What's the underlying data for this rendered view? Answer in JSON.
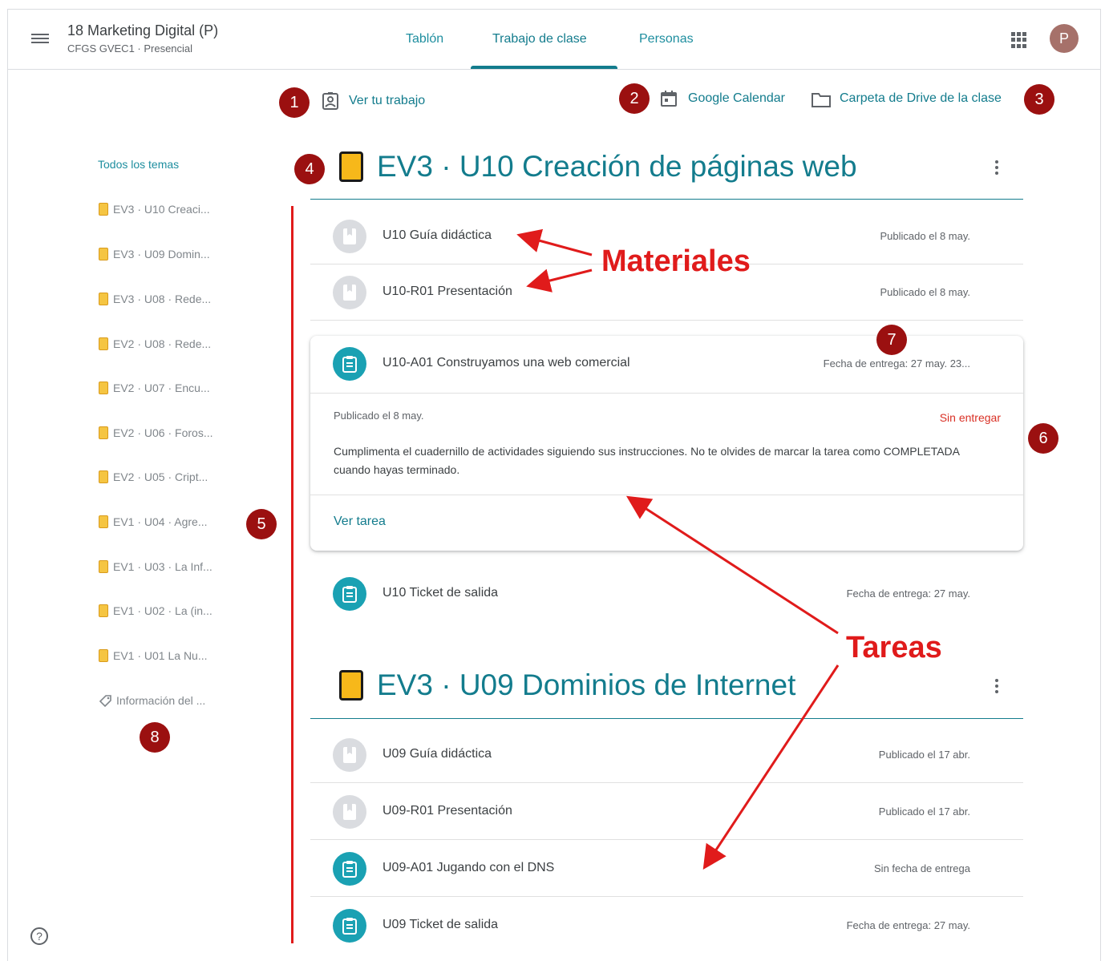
{
  "header": {
    "class_title": "18 Marketing Digital (P)",
    "class_subtitle": "CFGS GVEC1 · Presencial",
    "tabs": [
      "Tablón",
      "Trabajo de clase",
      "Personas"
    ],
    "active_tab": "Trabajo de clase",
    "avatar_letter": "P"
  },
  "toplinks": {
    "view_work": "Ver tu trabajo",
    "calendar": "Google Calendar",
    "drive": "Carpeta de Drive de la clase"
  },
  "sidebar": {
    "all_topics": "Todos los temas",
    "items": [
      "EV3 · U10 Creaci...",
      "EV3 · U09 Domin...",
      "EV3 · U08 · Rede...",
      "EV2 · U08 · Rede...",
      "EV2 · U07 · Encu...",
      "EV2 · U06 · Foros...",
      "EV2 · U05 · Cript...",
      "EV1 · U04 · Agre...",
      "EV1 · U03 · La Inf...",
      "EV1 · U02 · La (in...",
      "EV1 · U01 La Nu..."
    ],
    "info": "Información del ..."
  },
  "topics": [
    {
      "title": "EV3 · U10 Creación de páginas web",
      "rows": [
        {
          "title": "U10 Guía didáctica",
          "meta": "Publicado el 8 may.",
          "kind": "material"
        },
        {
          "title": "U10-R01 Presentación",
          "meta": "Publicado el 8 may.",
          "kind": "material"
        }
      ],
      "card": {
        "title": "U10-A01 Construyamos una web comercial",
        "meta": "Fecha de entrega: 27 may. 23...",
        "posted": "Publicado el 8 may.",
        "status": "Sin entregar",
        "description": "Cumplimenta el cuadernillo de actividades siguiendo sus instrucciones. No te olvides de marcar la tarea como COMPLETADA cuando hayas terminado.",
        "link": "Ver tarea"
      },
      "after_card": {
        "title": "U10 Ticket de salida",
        "meta": "Fecha de entrega: 27 may.",
        "kind": "task"
      }
    },
    {
      "title": "EV3 · U09 Dominios de Internet",
      "rows": [
        {
          "title": "U09 Guía didáctica",
          "meta": "Publicado el 17 abr.",
          "kind": "material"
        },
        {
          "title": "U09-R01 Presentación",
          "meta": "Publicado el 17 abr.",
          "kind": "material"
        },
        {
          "title": "U09-A01 Jugando con el DNS",
          "meta": "Sin fecha de entrega",
          "kind": "task"
        },
        {
          "title": "U09 Ticket de salida",
          "meta": "Fecha de entrega: 27 may.",
          "kind": "task"
        }
      ]
    }
  ],
  "annotations": {
    "badges": [
      "1",
      "2",
      "3",
      "4",
      "5",
      "6",
      "7",
      "8"
    ],
    "materiales": "Materiales",
    "tareas": "Tareas",
    "color": "#e01b1b",
    "badge_color": "#9b1010"
  },
  "colors": {
    "accent": "#137c8d",
    "status_red": "#d93025"
  }
}
